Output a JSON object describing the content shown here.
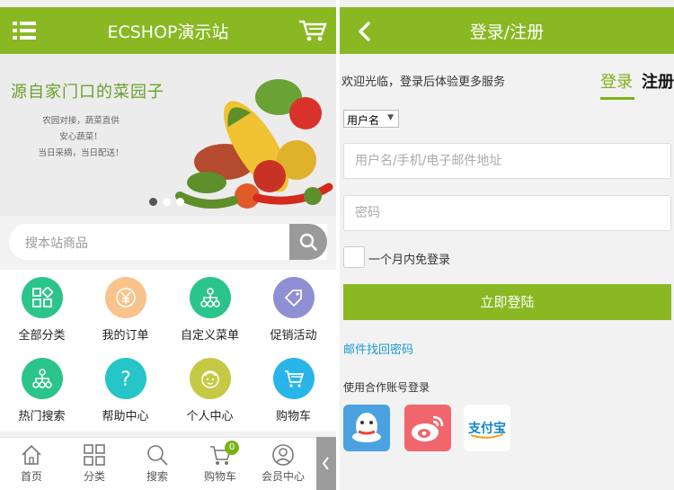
{
  "left": {
    "header": {
      "title": "ECSHOP演示站"
    },
    "banner": {
      "headline": "源自家门口的菜园子",
      "lines": [
        "农园对接，蔬菜直供",
        "安心蔬菜！",
        "当日采摘，当日配送！"
      ],
      "slide_count": 3,
      "active_slide": 1
    },
    "search": {
      "placeholder": "搜本站商品"
    },
    "grid": [
      {
        "label": "全部分类",
        "color": "#2bc48a",
        "icon": "grid-icon"
      },
      {
        "label": "我的订单",
        "color": "#f9c38c",
        "icon": "yen-icon"
      },
      {
        "label": "自定义菜单",
        "color": "#2bc48a",
        "icon": "sitemap-icon"
      },
      {
        "label": "促销活动",
        "color": "#8f8fd4",
        "icon": "tag-icon"
      },
      {
        "label": "热门搜索",
        "color": "#2bc48a",
        "icon": "sitemap-icon"
      },
      {
        "label": "帮助中心",
        "color": "#26c5c7",
        "icon": "question-icon"
      },
      {
        "label": "个人中心",
        "color": "#c6c944",
        "icon": "face-icon"
      },
      {
        "label": "购物车",
        "color": "#2ab5e8",
        "icon": "cart-icon"
      }
    ],
    "tabbar": [
      {
        "label": "首页",
        "icon": "home-icon"
      },
      {
        "label": "分类",
        "icon": "category-icon"
      },
      {
        "label": "搜索",
        "icon": "search-icon"
      },
      {
        "label": "购物车",
        "icon": "cart-icon",
        "badge": "0"
      },
      {
        "label": "会员中心",
        "icon": "user-icon"
      }
    ]
  },
  "right": {
    "header": {
      "title": "登录/注册"
    },
    "welcome": "欢迎光临，登录后体验更多服务",
    "tabs": {
      "login": "登录",
      "register": "注册"
    },
    "account_type": "用户名",
    "username_placeholder": "用户名/手机/电子邮件地址",
    "password_placeholder": "密码",
    "remember": "一个月内免登录",
    "submit": "立即登陆",
    "forgot": "邮件找回密码",
    "partner_title": "使用合作账号登录",
    "partners": [
      {
        "name": "QQ",
        "icon": "qq-icon",
        "color": "#4aa3e0"
      },
      {
        "name": "微博",
        "icon": "weibo-icon",
        "color": "#f0666c"
      },
      {
        "name": "支付宝",
        "icon": "alipay-icon",
        "color": "#ffffff"
      }
    ]
  },
  "colors": {
    "brand": "#8ab823",
    "link": "#1a9ad6"
  }
}
